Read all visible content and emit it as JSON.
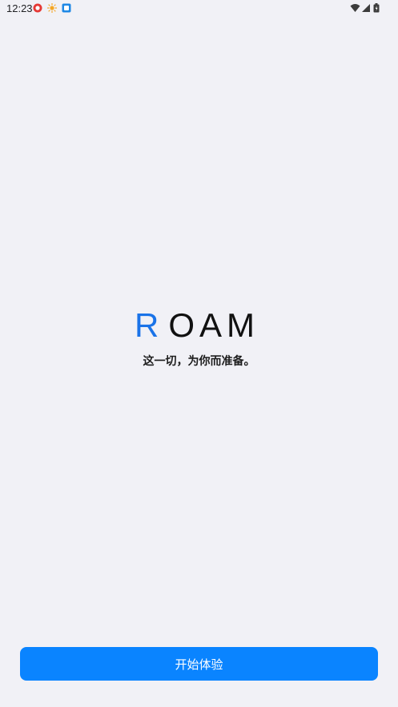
{
  "status_bar": {
    "time": "12:23",
    "left_icons": [
      "notification-app-icon",
      "brightness-icon",
      "app-store-icon"
    ],
    "right_icons": [
      "wifi-icon",
      "signal-icon",
      "battery-icon"
    ]
  },
  "brand": {
    "logo_first": "R",
    "logo_rest": "OAM",
    "accent_color": "#1a73e8",
    "tagline": "这一切，为你而准备。"
  },
  "actions": {
    "start_label": "开始体验",
    "button_color": "#0a84ff"
  }
}
